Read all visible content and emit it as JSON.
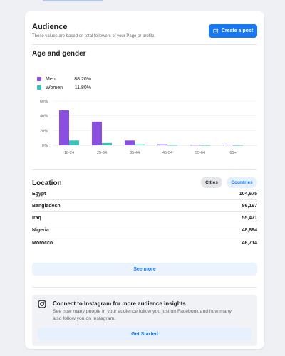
{
  "audience": {
    "title": "Audience",
    "subtitle": "These values are based on total followers of your Page or profile.",
    "create_post_label": "Create a post"
  },
  "age_gender": {
    "title": "Age and gender",
    "legend": [
      {
        "name": "Men",
        "value": "88.20%",
        "color": "#8a4fe0"
      },
      {
        "name": "Women",
        "value": "11.80%",
        "color": "#35c3b5"
      }
    ]
  },
  "chart_data": {
    "type": "bar",
    "categories": [
      "18-24",
      "25-34",
      "35-44",
      "45-54",
      "55-64",
      "65+"
    ],
    "series": [
      {
        "name": "Men",
        "color": "#8a4fe0",
        "values": [
          47.5,
          32.0,
          6.5,
          1.3,
          0.6,
          0.8
        ]
      },
      {
        "name": "Women",
        "color": "#35c3b5",
        "values": [
          6.5,
          3.0,
          1.2,
          0.4,
          0.3,
          0.3
        ]
      }
    ],
    "y_ticks": [
      "0%",
      "20%",
      "40%",
      "60%"
    ],
    "ylim": [
      0,
      60
    ],
    "grid": true
  },
  "location": {
    "title": "Location",
    "tabs": [
      {
        "label": "Cities",
        "active": false
      },
      {
        "label": "Countries",
        "active": true
      }
    ],
    "rows": [
      {
        "name": "Egypt",
        "value": "104,675"
      },
      {
        "name": "Bangladesh",
        "value": "86,197"
      },
      {
        "name": "Iraq",
        "value": "55,471"
      },
      {
        "name": "Nigeria",
        "value": "48,894"
      },
      {
        "name": "Morocco",
        "value": "46,714"
      }
    ],
    "see_more_label": "See more"
  },
  "instagram": {
    "title": "Connect to Instagram for more audience insights",
    "description": "See how many people in your audience follow you just on Facebook and how many also follow you on Instagram.",
    "button_label": "Get Started"
  }
}
